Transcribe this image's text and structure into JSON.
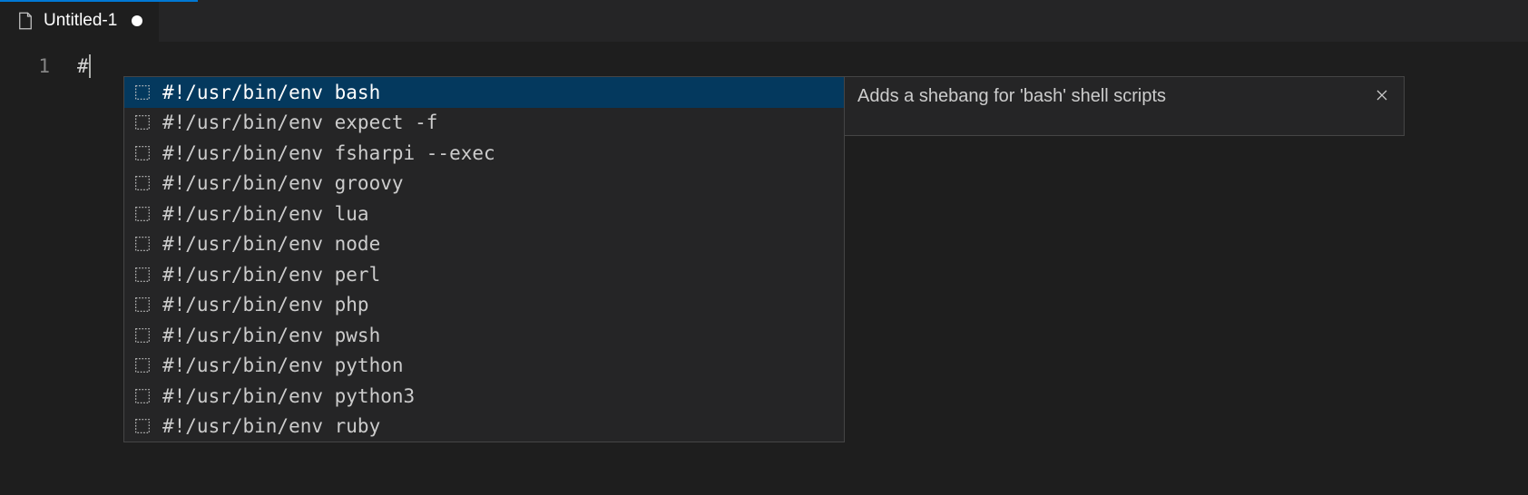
{
  "tab": {
    "label": "Untitled-1",
    "dirty": true
  },
  "editor": {
    "line_number": "1",
    "content": "#"
  },
  "suggest": {
    "items": [
      "#!/usr/bin/env bash",
      "#!/usr/bin/env expect -f",
      "#!/usr/bin/env fsharpi --exec",
      "#!/usr/bin/env groovy",
      "#!/usr/bin/env lua",
      "#!/usr/bin/env node",
      "#!/usr/bin/env perl",
      "#!/usr/bin/env php",
      "#!/usr/bin/env pwsh",
      "#!/usr/bin/env python",
      "#!/usr/bin/env python3",
      "#!/usr/bin/env ruby"
    ],
    "selected_index": 0,
    "details": "Adds a shebang for 'bash' shell scripts"
  }
}
